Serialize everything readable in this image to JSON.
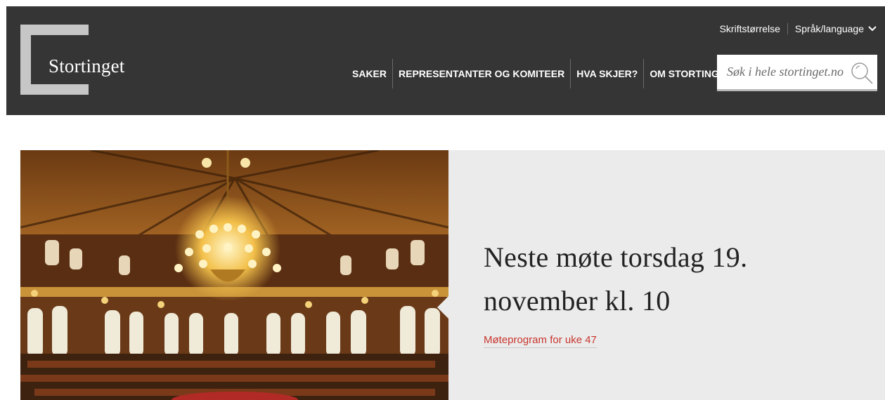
{
  "header": {
    "logo_text": "Stortinget",
    "utility": {
      "font_size_label": "Skriftstørrelse",
      "language_label": "Språk/language"
    },
    "nav": [
      {
        "label": "SAKER"
      },
      {
        "label": "REPRESENTANTER OG KOMITEER"
      },
      {
        "label": "HVA SKJER?"
      },
      {
        "label": "OM STORTINGET"
      }
    ],
    "search": {
      "placeholder": "Søk i hele stortinget.no"
    }
  },
  "hero": {
    "title": "Neste møte torsdag 19. november kl. 10",
    "link_label": "Møteprogram for uke 47"
  },
  "colors": {
    "header_bg": "#353535",
    "panel_bg": "#ebebeb",
    "link": "#c8362f",
    "logo_bracket": "#c6c6c6"
  },
  "icons": {
    "search": "magnifier-icon",
    "language": "chevron-down-icon"
  }
}
